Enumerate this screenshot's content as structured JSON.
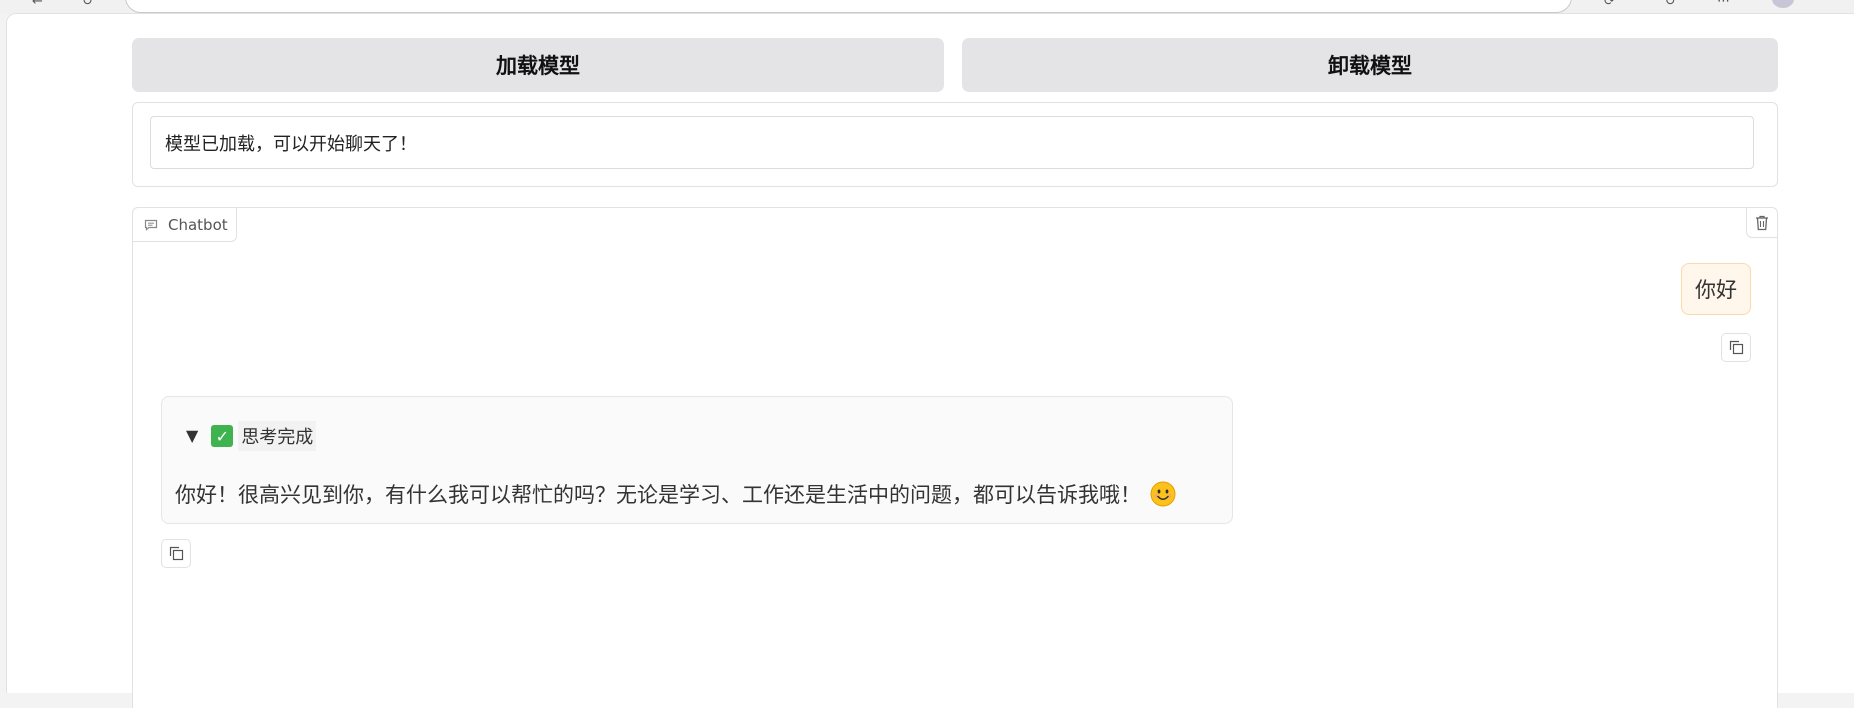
{
  "buttons": {
    "load_model": "加载模型",
    "unload_model": "卸载模型"
  },
  "status": {
    "value": "模型已加载，可以开始聊天了！"
  },
  "chatbot": {
    "label": "Chatbot",
    "icons": {
      "label_icon": "chat-icon",
      "clear": "trash-icon",
      "copy": "copy-icon"
    },
    "messages": [
      {
        "role": "user",
        "text": "你好"
      },
      {
        "role": "assistant",
        "thinking_status": "思考完成",
        "thinking_icon": "check-box-icon",
        "expand_icon": "triangle-down-icon",
        "text": "你好！很高兴见到你，有什么我可以帮忙的吗？无论是学习、工作还是生活中的问题，都可以告诉我哦！",
        "emoji": "smiling-face-icon"
      }
    ]
  },
  "colors": {
    "button_bg": "#e4e4e7",
    "user_bubble_bg": "#fff7ec",
    "user_bubble_border": "#fbd9a9",
    "check_green": "#3fb34f"
  }
}
